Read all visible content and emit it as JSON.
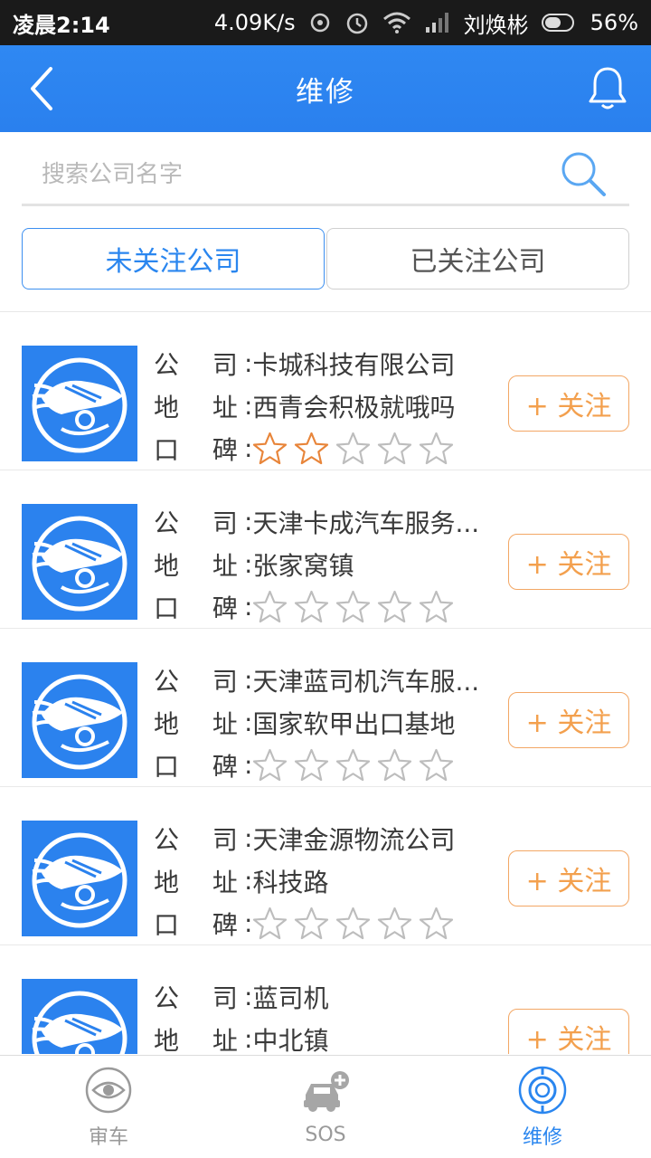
{
  "status_bar": {
    "time": "凌晨2:14",
    "speed": "4.09K/s",
    "carrier": "刘焕彬",
    "battery": "56%"
  },
  "header": {
    "title": "维修",
    "back_icon": "back-arrow-icon",
    "bell_icon": "bell-icon"
  },
  "search": {
    "placeholder": "搜索公司名字",
    "value": ""
  },
  "tabs": [
    {
      "label": "未关注公司",
      "active": true
    },
    {
      "label": "已关注公司",
      "active": false
    }
  ],
  "labels": {
    "company": "公 司",
    "address": "地 址",
    "rating": "口 碑",
    "colon": ":"
  },
  "follow_label": "+ 关注",
  "companies": [
    {
      "company": "卡城科技有限公司",
      "address": "西青会积极就哦吗",
      "rating": 2
    },
    {
      "company": "天津卡成汽车服务...",
      "address": "张家窝镇",
      "rating": 0
    },
    {
      "company": "天津蓝司机汽车服...",
      "address": "国家软甲出口基地",
      "rating": 0
    },
    {
      "company": "天津金源物流公司",
      "address": "科技路",
      "rating": 0
    },
    {
      "company": "蓝司机",
      "address": "中北镇",
      "rating": 0
    }
  ],
  "bottom_nav": [
    {
      "label": "审车",
      "icon": "eye-icon",
      "active": false
    },
    {
      "label": "SOS",
      "icon": "car-plus-icon",
      "active": false
    },
    {
      "label": "维修",
      "icon": "repair-circle-icon",
      "active": true
    }
  ],
  "colors": {
    "primary": "#2a86ef",
    "accent": "#f3a04e",
    "star_filled": "#e8853a",
    "star_empty": "#bdbdbd"
  }
}
